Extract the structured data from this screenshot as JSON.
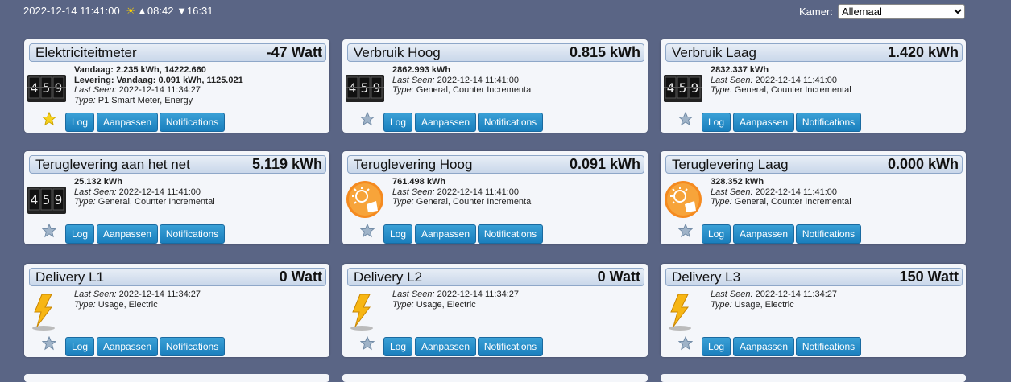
{
  "header": {
    "datetime": "2022-12-14 11:41:00",
    "sunrise": "▲08:42",
    "sunset": "▼16:31",
    "room_label": "Kamer:",
    "room_value": "Allemaal"
  },
  "buttons": {
    "log": "Log",
    "edit": "Aanpassen",
    "notifications": "Notifications"
  },
  "cards": [
    {
      "name": "Elektriciteitmeter",
      "value": "-47 Watt",
      "icon": "counter-icon",
      "favorite": true,
      "line1": "Vandaag: 2.235 kWh, 14222.660",
      "line2": "Levering: Vandaag: 0.091 kWh, 1125.021",
      "last_seen_label": "Last Seen:",
      "last_seen": "2022-12-14 11:34:27",
      "type_label": "Type:",
      "type": "P1 Smart Meter, Energy"
    },
    {
      "name": "Verbruik Hoog",
      "value": "0.815 kWh",
      "icon": "counter-icon",
      "favorite": false,
      "line1": "2862.993 kWh",
      "last_seen_label": "Last Seen:",
      "last_seen": "2022-12-14 11:41:00",
      "type_label": "Type:",
      "type": "General, Counter Incremental"
    },
    {
      "name": "Verbruik Laag",
      "value": "1.420 kWh",
      "icon": "counter-icon",
      "favorite": false,
      "line1": "2832.337 kWh",
      "last_seen_label": "Last Seen:",
      "last_seen": "2022-12-14 11:41:00",
      "type_label": "Type:",
      "type": "General, Counter Incremental"
    },
    {
      "name": "Teruglevering aan het net",
      "value": "5.119 kWh",
      "icon": "counter-icon",
      "favorite": false,
      "line1": "25.132 kWh",
      "last_seen_label": "Last Seen:",
      "last_seen": "2022-12-14 11:41:00",
      "type_label": "Type:",
      "type": "General, Counter Incremental"
    },
    {
      "name": "Teruglevering Hoog",
      "value": "0.091 kWh",
      "icon": "solar-icon",
      "favorite": false,
      "line1": "761.498 kWh",
      "last_seen_label": "Last Seen:",
      "last_seen": "2022-12-14 11:41:00",
      "type_label": "Type:",
      "type": "General, Counter Incremental"
    },
    {
      "name": "Teruglevering Laag",
      "value": "0.000 kWh",
      "icon": "solar-icon",
      "favorite": false,
      "line1": "328.352 kWh",
      "last_seen_label": "Last Seen:",
      "last_seen": "2022-12-14 11:41:00",
      "type_label": "Type:",
      "type": "General, Counter Incremental"
    },
    {
      "name": "Delivery L1",
      "value": "0 Watt",
      "icon": "lightning-icon",
      "favorite": false,
      "last_seen_label": "Last Seen:",
      "last_seen": "2022-12-14 11:34:27",
      "type_label": "Type:",
      "type": "Usage, Electric"
    },
    {
      "name": "Delivery L2",
      "value": "0 Watt",
      "icon": "lightning-icon",
      "favorite": false,
      "last_seen_label": "Last Seen:",
      "last_seen": "2022-12-14 11:34:27",
      "type_label": "Type:",
      "type": "Usage, Electric"
    },
    {
      "name": "Delivery L3",
      "value": "150 Watt",
      "icon": "lightning-icon",
      "favorite": false,
      "last_seen_label": "Last Seen:",
      "last_seen": "2022-12-14 11:34:27",
      "type_label": "Type:",
      "type": "Usage, Electric"
    }
  ]
}
